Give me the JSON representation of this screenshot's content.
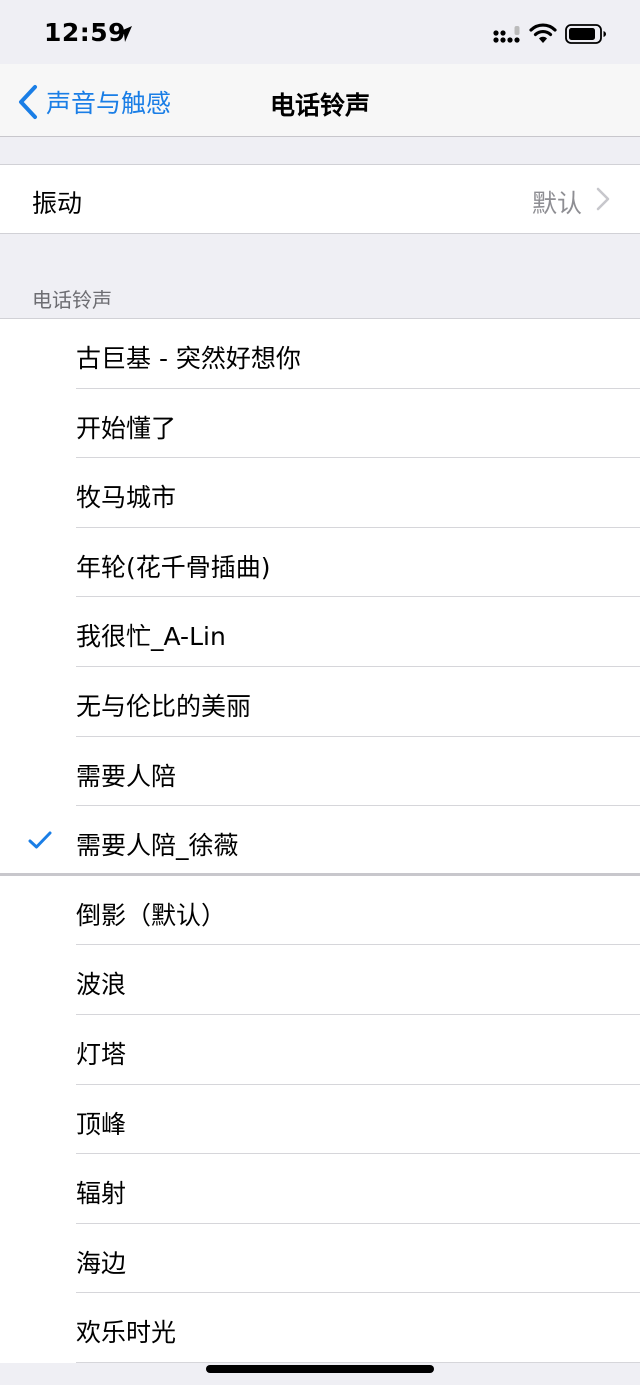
{
  "status_bar": {
    "time": "12:59",
    "icons": [
      "location-arrow-icon",
      "signal-icon",
      "wifi-icon",
      "battery-icon"
    ]
  },
  "nav": {
    "back_label": "声音与触感",
    "title": "电话铃声"
  },
  "vibration": {
    "label": "振动",
    "value": "默认"
  },
  "ringtones_header": "电话铃声",
  "ringtones": [
    {
      "label": "古巨基 - 突然好想你",
      "selected": false
    },
    {
      "label": "开始懂了",
      "selected": false
    },
    {
      "label": "牧马城市",
      "selected": false
    },
    {
      "label": "年轮(花千骨插曲)",
      "selected": false
    },
    {
      "label": "我很忙_A-Lin",
      "selected": false
    },
    {
      "label": "无与伦比的美丽",
      "selected": false
    },
    {
      "label": "需要人陪",
      "selected": false
    },
    {
      "label": "需要人陪_徐薇",
      "selected": true
    },
    {
      "label": "倒影（默认）",
      "selected": false
    },
    {
      "label": "波浪",
      "selected": false
    },
    {
      "label": "灯塔",
      "selected": false
    },
    {
      "label": "顶峰",
      "selected": false
    },
    {
      "label": "辐射",
      "selected": false
    },
    {
      "label": "海边",
      "selected": false
    },
    {
      "label": "欢乐时光",
      "selected": false
    }
  ],
  "colors": {
    "accent": "#1a7ee6",
    "secondary_text": "#8e8e93",
    "background": "#efeff4"
  }
}
